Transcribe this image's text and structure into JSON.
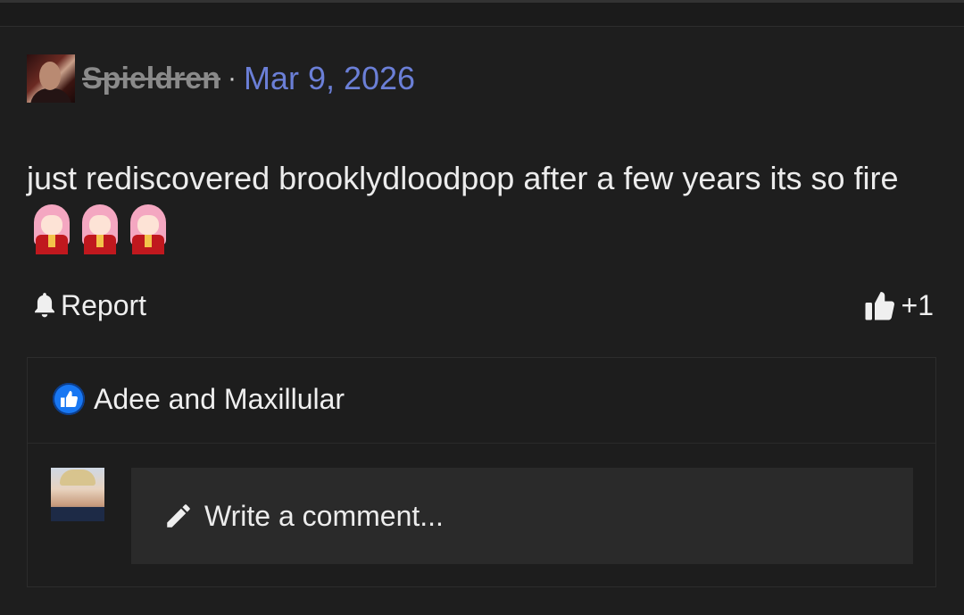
{
  "post": {
    "author": "Spieldren",
    "separator": "·",
    "date": "Mar 9, 2026",
    "text": "just rediscovered brooklydloodpop after a few years its so fire",
    "emoji_count": 3,
    "emoji_icon": "anime-girl-emoji"
  },
  "actions": {
    "report_label": "Report",
    "like_count": "+1"
  },
  "reactions": {
    "liked_by": "Adee and Maxillular"
  },
  "comment": {
    "placeholder": "Write a comment..."
  },
  "colors": {
    "background": "#1e1e1e",
    "date_link": "#6b7fd7",
    "like_badge": "#1877f2",
    "input_bg": "#2a2a2a"
  }
}
